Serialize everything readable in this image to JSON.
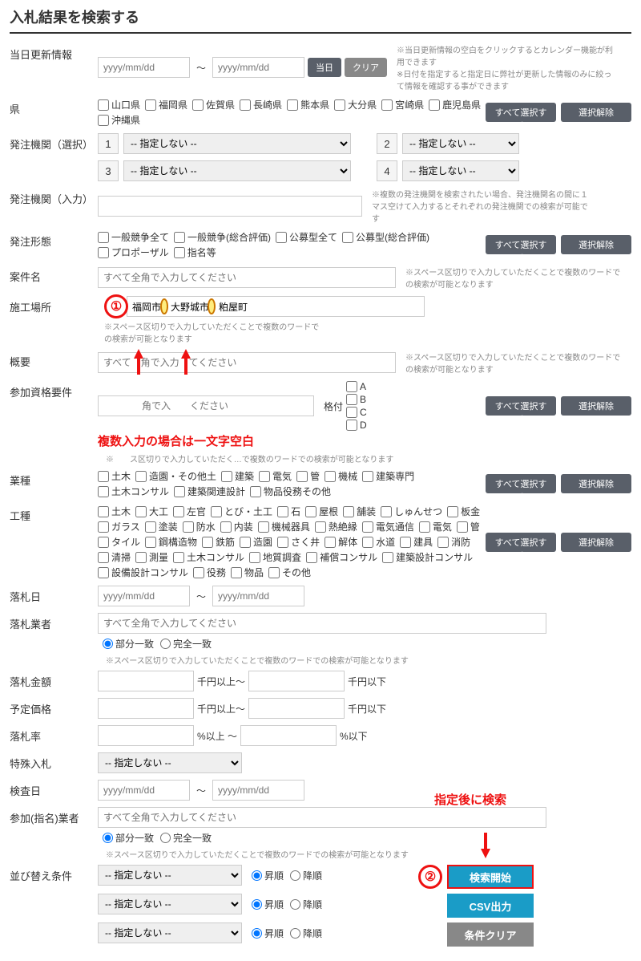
{
  "title": "入札結果を検索する",
  "labels": {
    "update": "当日更新情報",
    "pref": "県",
    "org_sel": "発注機関（選択）",
    "org_in": "発注機関（入力）",
    "form": "発注形態",
    "name": "案件名",
    "place": "施工場所",
    "summary": "概要",
    "qual": "参加資格要件",
    "gyoshu": "業種",
    "koushu": "工種",
    "rakudate": "落札日",
    "rakubiz": "落札業者",
    "rakuamt": "落札金額",
    "yotei": "予定価格",
    "rakurate": "落札率",
    "special": "特殊入札",
    "kensa": "検査日",
    "sanka": "参加(指名)業者",
    "sort": "並び替え条件"
  },
  "placeholders": {
    "date": "yyyy/mm/dd",
    "zenkaku": "すべて全角で入力してください",
    "zenkaku2": "すべて全角で入力してください",
    "summary_ph": "すべて　角で入力　てください",
    "qual_ph": "　　　　角で入　　ください",
    "hint_space": "※　　ス区切りで入力していただく…で複数のワードでの検索が可能となります"
  },
  "buttons": {
    "today": "当日",
    "clear": "クリア",
    "selectall": "すべて選択する",
    "deselect": "選択解除",
    "search": "検索開始",
    "csv": "CSV出力",
    "condclear": "条件クリア"
  },
  "notes": {
    "update": "※当日更新情報の空白をクリックするとカレンダー機能が利用できます\n※日付を指定すると指定日に弊社が更新した情報のみに絞って情報を確認する事ができます",
    "org_in": "※複数の発注機関を検索されたい場合、発注機関名の間に１マス空けて入力するとそれぞれの発注機関での検索が可能です",
    "multi": "※スペース区切りで入力していただくことで複数のワードでの検索が可能となります",
    "hint2": "※スペース区切りで入力していただくことで複数のワードでの検索が可能となります"
  },
  "prefs": [
    "山口県",
    "福岡県",
    "佐賀県",
    "長崎県",
    "熊本県",
    "大分県",
    "宮崎県",
    "鹿児島県",
    "沖縄県"
  ],
  "nospec": "-- 指定しない --",
  "forms": [
    "一般競争全て",
    "一般競争(総合評価)",
    "公募型全て",
    "公募型(総合評価)",
    "プロポーザル",
    "指名等"
  ],
  "place_value": "福岡市　大野城市　粕屋町",
  "kakutsuke": "格付",
  "grades": [
    "A",
    "B",
    "C",
    "D"
  ],
  "gyoshu_items": [
    "土木",
    "造園・その他土",
    "建築",
    "電気",
    "管",
    "機械",
    "建築専門",
    "土木コンサル",
    "建築関連設計",
    "物品役務その他"
  ],
  "koushu_items": [
    "土木",
    "大工",
    "左官",
    "とび・土工",
    "石",
    "屋根",
    "舗装",
    "しゅんせつ",
    "板金",
    "ガラス",
    "塗装",
    "防水",
    "内装",
    "機械器具",
    "熱絶縁",
    "電気通信",
    "電気",
    "管",
    "タイル",
    "鋼構造物",
    "鉄筋",
    "造園",
    "さく井",
    "解体",
    "水道",
    "建具",
    "消防",
    "清掃",
    "測量",
    "土木コンサル",
    "地質調査",
    "補償コンサル",
    "建築設計コンサル",
    "設備設計コンサル",
    "役務",
    "物品",
    "その他"
  ],
  "yen_up": "千円以上～",
  "yen_down": "千円以下",
  "pct_up": "%以上 ～",
  "pct_down": "%以下",
  "match_part": "部分一致",
  "match_full": "完全一致",
  "asc": "昇順",
  "desc": "降順",
  "anno1": "複数入力の場合は一文字空白",
  "anno2": "指定後に検索"
}
